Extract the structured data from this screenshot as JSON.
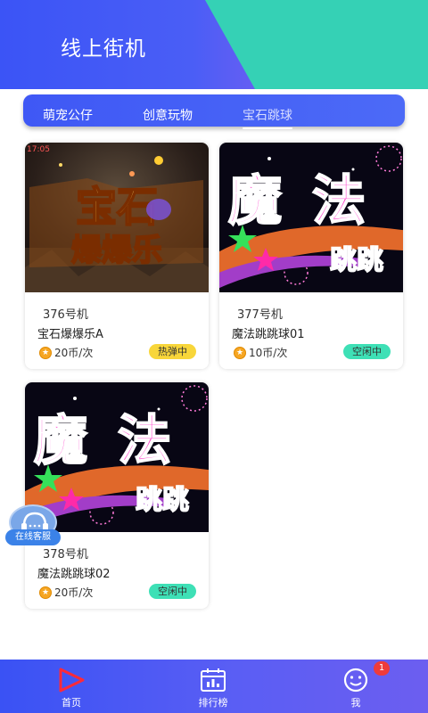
{
  "header": {
    "title": "线上街机"
  },
  "tabs": [
    {
      "label": "萌宠公仔"
    },
    {
      "label": "创意玩物"
    },
    {
      "label": "宝石跳球"
    }
  ],
  "cards": [
    {
      "number": "376号机",
      "name": "宝石爆爆乐A",
      "price": "20币/次",
      "status": "热弹中",
      "thumb_text": [
        "宝石",
        "爆爆乐"
      ],
      "thumb_timestamp": "17:05"
    },
    {
      "number": "377号机",
      "name": "魔法跳跳球01",
      "price": "10币/次",
      "status": "空闲中",
      "thumb_text": [
        "魔",
        "法",
        "跳跳"
      ]
    },
    {
      "number": "378号机",
      "name": "魔法跳跳球02",
      "price": "20币/次",
      "status": "空闲中",
      "thumb_text": [
        "魔",
        "法",
        "跳跳"
      ]
    }
  ],
  "service": {
    "label": "在线客服",
    "icon": "headset-icon"
  },
  "bottom_nav": [
    {
      "label": "首页",
      "icon": "play-triangle-icon"
    },
    {
      "label": "排行榜",
      "icon": "calendar-chart-icon"
    },
    {
      "label": "我",
      "icon": "smiley-icon"
    }
  ],
  "notification_count": "1",
  "colors": {
    "primary": "#3b54f6",
    "teal": "#35d1b5",
    "hot": "#f8d63a",
    "free": "#3ee0b6"
  }
}
